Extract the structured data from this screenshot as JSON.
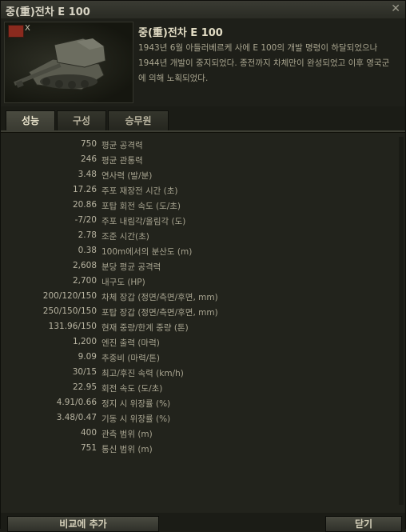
{
  "window": {
    "title": "중(重)전차 E 100"
  },
  "header": {
    "tier_mark": "X",
    "tank_name": "중(重)전차 E 100",
    "description": "1943년 6월 아들러베르케 사에 E 100의 개발 명령이 하달되었으나 1944년 개발이 중지되었다. 종전까지 차체만이 완성되었고 이후 영국군에 의해 노획되었다."
  },
  "tabs": [
    {
      "label": "성능",
      "active": true
    },
    {
      "label": "구성",
      "active": false
    },
    {
      "label": "승무원",
      "active": false
    }
  ],
  "stats": [
    {
      "value": "750",
      "label": "평균 공격력"
    },
    {
      "value": "246",
      "label": "평균 관통력"
    },
    {
      "value": "3.48",
      "label": "연사력 (발/분)"
    },
    {
      "value": "17.26",
      "label": "주포 재장전 시간 (초)"
    },
    {
      "value": "20.86",
      "label": "포탑 회전 속도 (도/초)"
    },
    {
      "value": "-7/20",
      "label": "주포 내림각/올림각 (도)"
    },
    {
      "value": "2.78",
      "label": "조준 시간(초)"
    },
    {
      "value": "0.38",
      "label": "100m에서의 분산도 (m)"
    },
    {
      "value": "2,608",
      "label": "분당 평균 공격력"
    },
    {
      "value": "2,700",
      "label": "내구도 (HP)"
    },
    {
      "value": "200/120/150",
      "label": "차체 장갑 (정면/측면/후면, mm)"
    },
    {
      "value": "250/150/150",
      "label": "포탑 장갑 (정면/측면/후면, mm)"
    },
    {
      "value": "131.96/150",
      "label": "현재 중량/한계 중량 (톤)"
    },
    {
      "value": "1,200",
      "label": "엔진 출력 (마력)"
    },
    {
      "value": "9.09",
      "label": "추중비 (마력/톤)"
    },
    {
      "value": "30/15",
      "label": "최고/후진 속력 (km/h)"
    },
    {
      "value": "22.95",
      "label": "회전 속도 (도/초)"
    },
    {
      "value": "4.91/0.66",
      "label": "정지 시 위장률 (%)"
    },
    {
      "value": "3.48/0.47",
      "label": "기동 시 위장률 (%)"
    },
    {
      "value": "400",
      "label": "관측 범위 (m)"
    },
    {
      "value": "751",
      "label": "통신 범위 (m)"
    }
  ],
  "footer": {
    "compare_label": "비교에 추가",
    "close_label": "닫기"
  }
}
